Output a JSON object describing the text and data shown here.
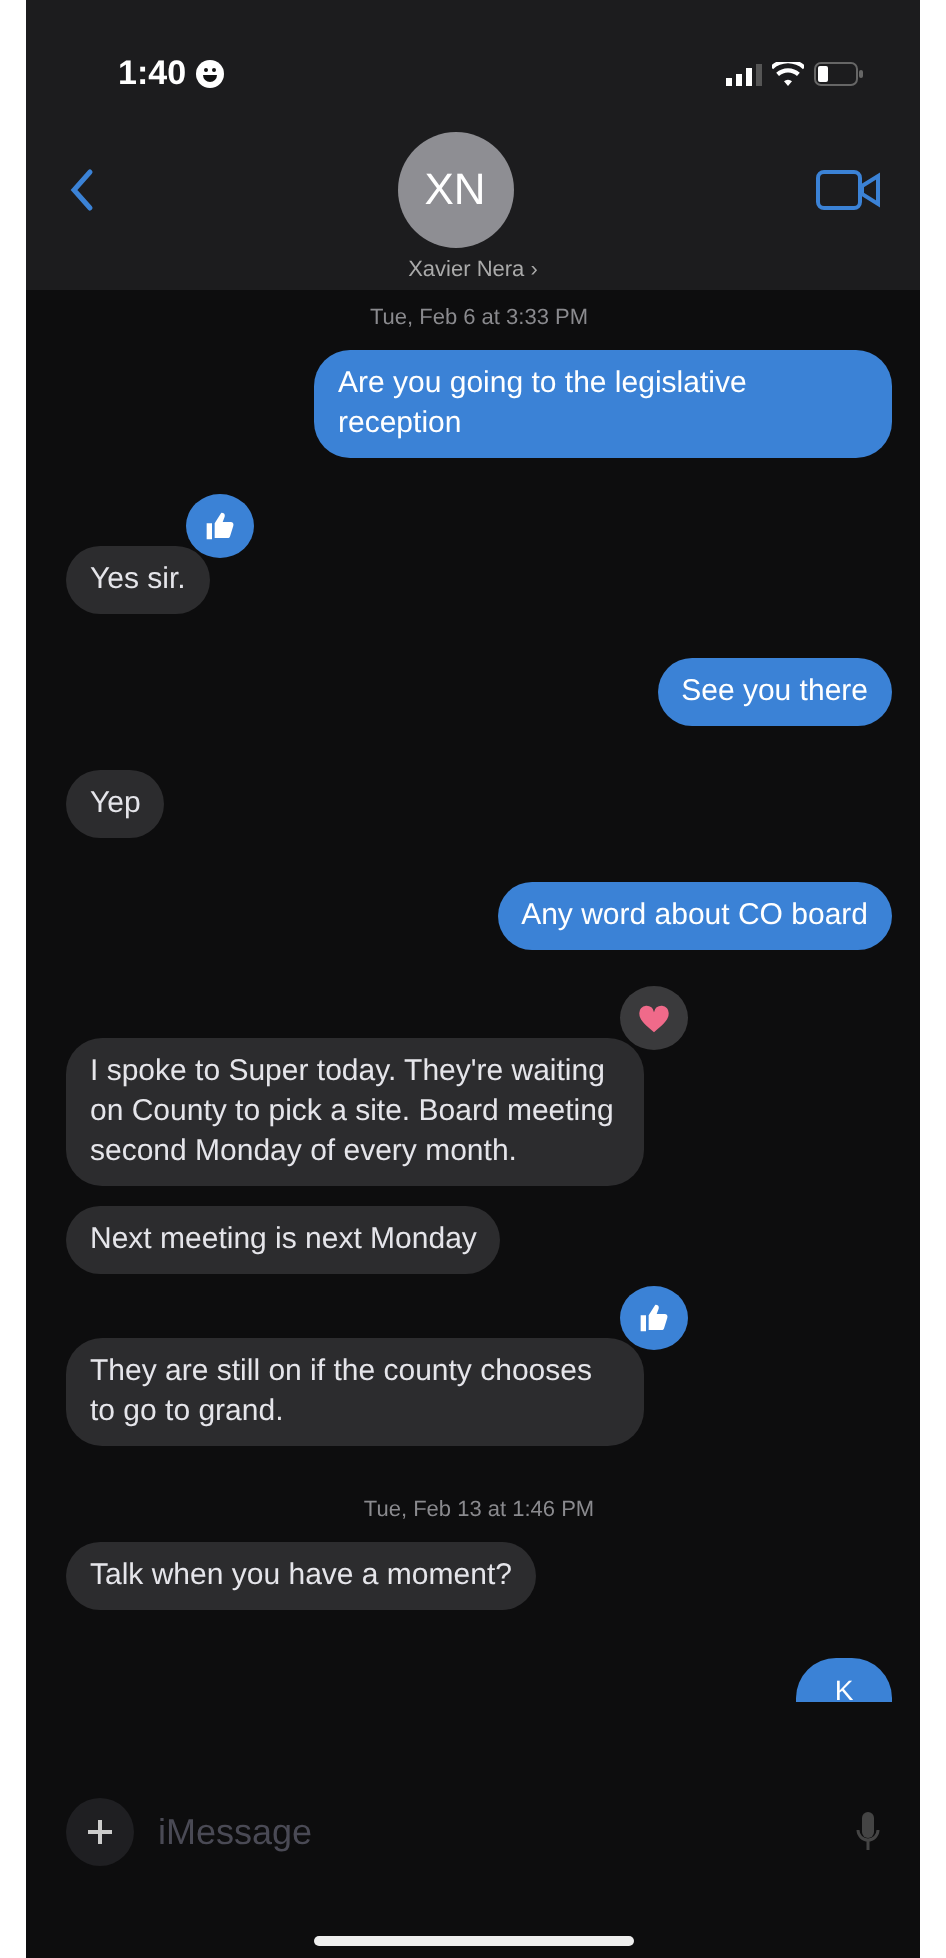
{
  "status_bar": {
    "time": "1:40"
  },
  "contact": {
    "initials": "XN",
    "name": "Xavier Nera",
    "chevron": "›"
  },
  "thread": [
    {
      "kind": "timestamp",
      "text": "Tue, Feb 6 at 3:33 PM"
    },
    {
      "kind": "sent",
      "text": "Are you going to the legislative reception"
    },
    {
      "kind": "received",
      "text": "Yes sir.",
      "reaction": {
        "kind": "thumbs"
      }
    },
    {
      "kind": "sent",
      "text": "See you there"
    },
    {
      "kind": "received",
      "text": "Yep"
    },
    {
      "kind": "sent",
      "text": "Any word about CO board"
    },
    {
      "kind": "received",
      "text": "I spoke to Super today. They're waiting on County to pick a site. Board meeting second Monday of every month.",
      "reaction": {
        "kind": "heart"
      }
    },
    {
      "kind": "received",
      "text": "Next meeting is next Monday"
    },
    {
      "kind": "received",
      "text": "They are still on if the county chooses to go to grand.",
      "reaction": {
        "kind": "thumbs"
      }
    },
    {
      "kind": "timestamp",
      "text": "Tue, Feb 13 at 1:46 PM"
    },
    {
      "kind": "received",
      "text": "Talk when you have a moment?"
    },
    {
      "kind": "sent-partial",
      "text": "K"
    }
  ],
  "composer": {
    "placeholder": "iMessage"
  }
}
